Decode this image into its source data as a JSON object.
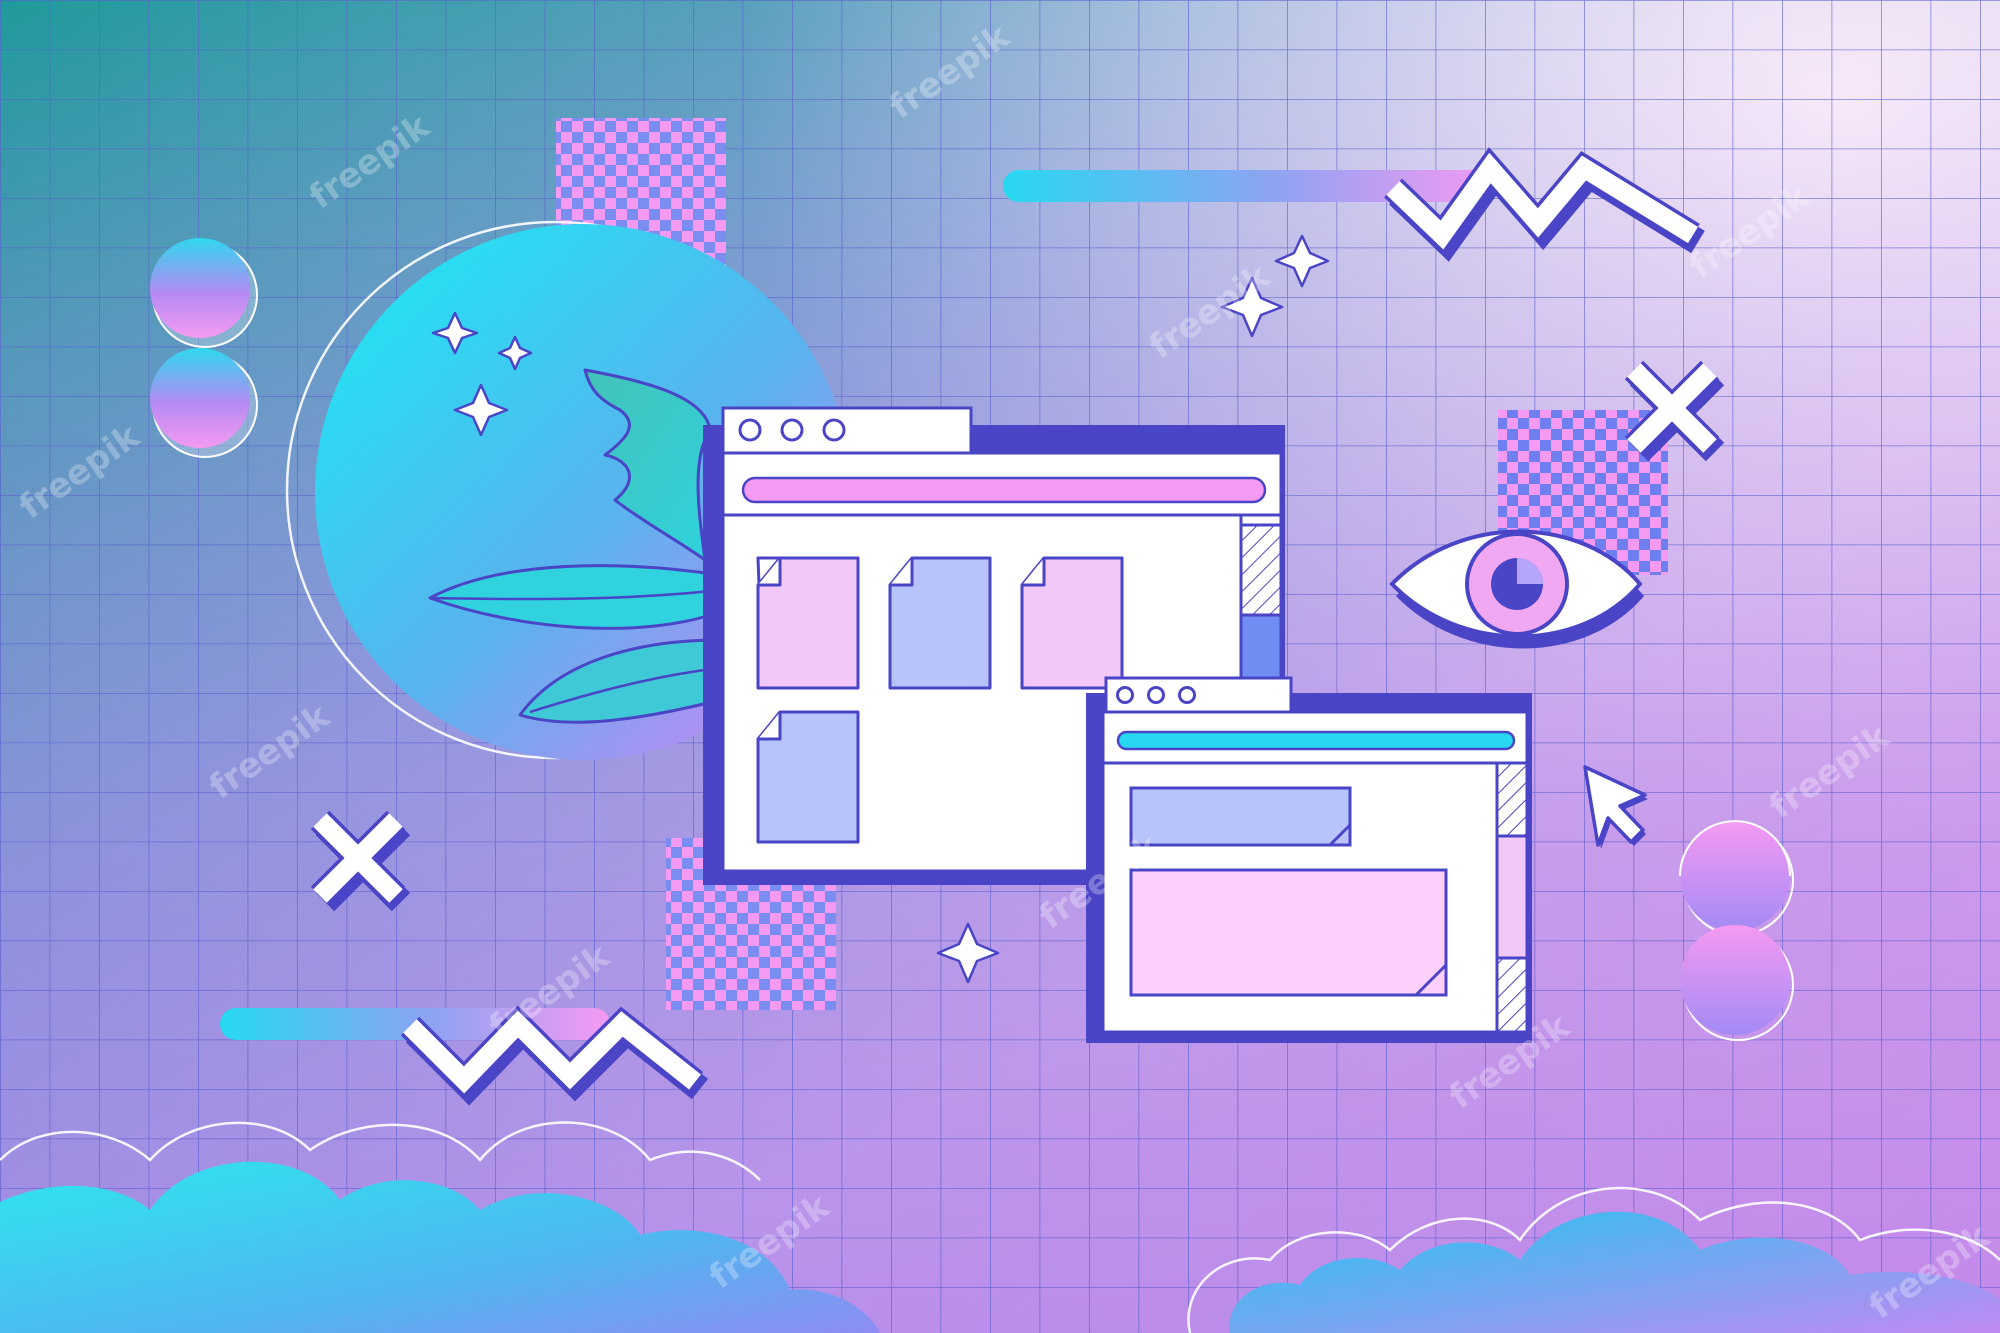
{
  "illustration": {
    "style": "vaporwave gradient desktop",
    "colors": {
      "bg_top_left": "#279aa0",
      "bg_mid": "#a9aee0",
      "bg_right": "#fbd0f5",
      "bg_bottom": "#b889ee",
      "grid_line": "#5a5fd0",
      "outline": "#4a45c6",
      "pink": "#f59af2",
      "cyan": "#27d8f0",
      "blue": "#6f8df2",
      "lavender": "#b6c4fb",
      "light_pink": "#f1c8f8",
      "window_fill": "#ffffff"
    },
    "icons": [
      "moon-globe-icon",
      "monstera-leaf-icon",
      "sparkle-icon",
      "zigzag-icon",
      "close-x-icon",
      "eye-icon",
      "cursor-arrow-icon",
      "file-icon",
      "checkerboard-icon",
      "cloud-icon",
      "orb-icon"
    ]
  },
  "watermark": {
    "text": "freepik"
  }
}
